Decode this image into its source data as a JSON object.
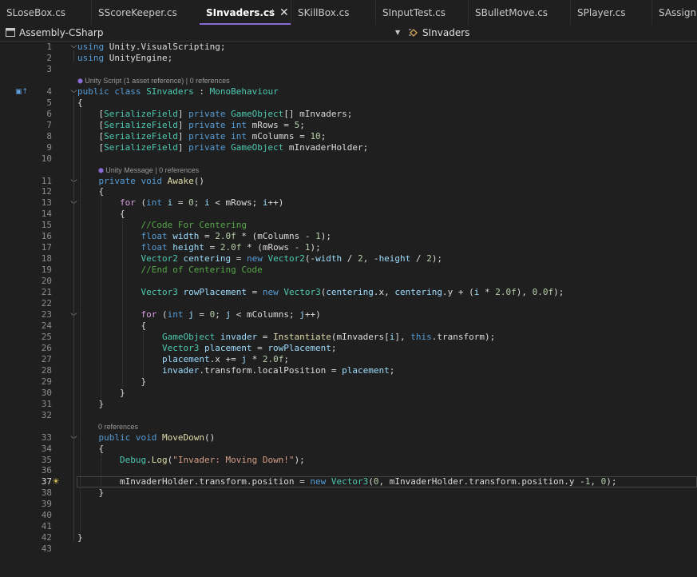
{
  "tabs": [
    {
      "label": "SLoseBox.cs",
      "active": false
    },
    {
      "label": "SScoreKeeper.cs",
      "active": false
    },
    {
      "label": "SInvaders.cs",
      "active": true,
      "pin_icon": "pin-icon",
      "close_icon": "close-icon"
    },
    {
      "label": "SKillBox.cs",
      "active": false
    },
    {
      "label": "SInputTest.cs",
      "active": false
    },
    {
      "label": "SBulletMove.cs",
      "active": false
    },
    {
      "label": "SPlayer.cs",
      "active": false
    },
    {
      "label": "SAssignm",
      "active": false
    }
  ],
  "nav": {
    "project": "Assembly-CSharp",
    "class": "SInvaders",
    "project_icon": "csharp-project-icon",
    "class_icon": "class-icon",
    "dropdown_icon": "chevron-down-icon"
  },
  "editor": {
    "current_line": 37,
    "accent_color": "#8a6ad6",
    "lens_icon": "unity-icon",
    "inherit_icon": "inherits-icon",
    "quick_action_icon": "lightbulb-icon",
    "lines": [
      {
        "n": 1,
        "fold": "open",
        "tokens": [
          [
            "kw",
            "using"
          ],
          [
            "pl",
            " Unity.VisualScripting;"
          ]
        ]
      },
      {
        "n": 2,
        "tokens": [
          [
            "kw",
            "using"
          ],
          [
            "pl",
            " UnityEngine;"
          ]
        ]
      },
      {
        "n": 3,
        "tokens": []
      },
      {
        "lens": "Unity Script (1 asset reference) | 0 references",
        "lens_icon": true,
        "lens_indent": 0
      },
      {
        "n": 4,
        "fold": "open",
        "tokens": [
          [
            "kw",
            "public"
          ],
          [
            "pl",
            " "
          ],
          [
            "kw",
            "class"
          ],
          [
            "pl",
            " "
          ],
          [
            "ty",
            "SInvaders"
          ],
          [
            "pl",
            " : "
          ],
          [
            "ty",
            "MonoBehaviour"
          ]
        ]
      },
      {
        "n": 5,
        "tokens": [
          [
            "pl",
            "{"
          ]
        ]
      },
      {
        "n": 6,
        "tokens": [
          [
            "pl",
            "    ["
          ],
          [
            "ty",
            "SerializeField"
          ],
          [
            "pl",
            "] "
          ],
          [
            "kw",
            "private"
          ],
          [
            "pl",
            " "
          ],
          [
            "ty",
            "GameObject"
          ],
          [
            "pl",
            "[] mInvaders;"
          ]
        ]
      },
      {
        "n": 7,
        "tokens": [
          [
            "pl",
            "    ["
          ],
          [
            "ty",
            "SerializeField"
          ],
          [
            "pl",
            "] "
          ],
          [
            "kw",
            "private"
          ],
          [
            "pl",
            " "
          ],
          [
            "kw",
            "int"
          ],
          [
            "pl",
            " mRows = "
          ],
          [
            "nm",
            "5"
          ],
          [
            "pl",
            ";"
          ]
        ]
      },
      {
        "n": 8,
        "tokens": [
          [
            "pl",
            "    ["
          ],
          [
            "ty",
            "SerializeField"
          ],
          [
            "pl",
            "] "
          ],
          [
            "kw",
            "private"
          ],
          [
            "pl",
            " "
          ],
          [
            "kw",
            "int"
          ],
          [
            "pl",
            " mColumns = "
          ],
          [
            "nm",
            "10"
          ],
          [
            "pl",
            ";"
          ]
        ]
      },
      {
        "n": 9,
        "tokens": [
          [
            "pl",
            "    ["
          ],
          [
            "ty",
            "SerializeField"
          ],
          [
            "pl",
            "] "
          ],
          [
            "kw",
            "private"
          ],
          [
            "pl",
            " "
          ],
          [
            "ty",
            "GameObject"
          ],
          [
            "pl",
            " mInvaderHolder;"
          ]
        ]
      },
      {
        "n": 10,
        "tokens": []
      },
      {
        "lens": "Unity Message | 0 references",
        "lens_icon": true,
        "lens_indent": 4
      },
      {
        "n": 11,
        "fold": "open",
        "tokens": [
          [
            "pl",
            "    "
          ],
          [
            "kw",
            "private"
          ],
          [
            "pl",
            " "
          ],
          [
            "kw",
            "void"
          ],
          [
            "pl",
            " "
          ],
          [
            "mt",
            "Awake"
          ],
          [
            "pl",
            "()"
          ]
        ]
      },
      {
        "n": 12,
        "tokens": [
          [
            "pl",
            "    {"
          ]
        ]
      },
      {
        "n": 13,
        "fold": "open",
        "tokens": [
          [
            "pl",
            "        "
          ],
          [
            "kc",
            "for"
          ],
          [
            "pl",
            " ("
          ],
          [
            "kw",
            "int"
          ],
          [
            "pl",
            " "
          ],
          [
            "vr",
            "i"
          ],
          [
            "pl",
            " = "
          ],
          [
            "nm",
            "0"
          ],
          [
            "pl",
            "; "
          ],
          [
            "vr",
            "i"
          ],
          [
            "pl",
            " < mRows; "
          ],
          [
            "vr",
            "i"
          ],
          [
            "pl",
            "++)"
          ]
        ]
      },
      {
        "n": 14,
        "tokens": [
          [
            "pl",
            "        {"
          ]
        ]
      },
      {
        "n": 15,
        "tokens": [
          [
            "pl",
            "            "
          ],
          [
            "cm",
            "//Code For Centering"
          ]
        ]
      },
      {
        "n": 16,
        "tokens": [
          [
            "pl",
            "            "
          ],
          [
            "kw",
            "float"
          ],
          [
            "pl",
            " "
          ],
          [
            "vr",
            "width"
          ],
          [
            "pl",
            " = "
          ],
          [
            "nm",
            "2.0f"
          ],
          [
            "pl",
            " * (mColumns - "
          ],
          [
            "nm",
            "1"
          ],
          [
            "pl",
            ");"
          ]
        ]
      },
      {
        "n": 17,
        "tokens": [
          [
            "pl",
            "            "
          ],
          [
            "kw",
            "float"
          ],
          [
            "pl",
            " "
          ],
          [
            "vr",
            "height"
          ],
          [
            "pl",
            " = "
          ],
          [
            "nm",
            "2.0f"
          ],
          [
            "pl",
            " * (mRows - "
          ],
          [
            "nm",
            "1"
          ],
          [
            "pl",
            ");"
          ]
        ]
      },
      {
        "n": 18,
        "tokens": [
          [
            "pl",
            "            "
          ],
          [
            "ty",
            "Vector2"
          ],
          [
            "pl",
            " "
          ],
          [
            "vr",
            "centering"
          ],
          [
            "pl",
            " = "
          ],
          [
            "kw",
            "new"
          ],
          [
            "pl",
            " "
          ],
          [
            "ty",
            "Vector2"
          ],
          [
            "pl",
            "(-"
          ],
          [
            "vr",
            "width"
          ],
          [
            "pl",
            " / "
          ],
          [
            "nm",
            "2"
          ],
          [
            "pl",
            ", -"
          ],
          [
            "vr",
            "height"
          ],
          [
            "pl",
            " / "
          ],
          [
            "nm",
            "2"
          ],
          [
            "pl",
            ");"
          ]
        ]
      },
      {
        "n": 19,
        "tokens": [
          [
            "pl",
            "            "
          ],
          [
            "cm",
            "//End of Centering Code"
          ]
        ]
      },
      {
        "n": 20,
        "tokens": []
      },
      {
        "n": 21,
        "tokens": [
          [
            "pl",
            "            "
          ],
          [
            "ty",
            "Vector3"
          ],
          [
            "pl",
            " "
          ],
          [
            "vr",
            "rowPlacement"
          ],
          [
            "pl",
            " = "
          ],
          [
            "kw",
            "new"
          ],
          [
            "pl",
            " "
          ],
          [
            "ty",
            "Vector3"
          ],
          [
            "pl",
            "("
          ],
          [
            "vr",
            "centering"
          ],
          [
            "pl",
            ".x, "
          ],
          [
            "vr",
            "centering"
          ],
          [
            "pl",
            ".y + ("
          ],
          [
            "vr",
            "i"
          ],
          [
            "pl",
            " * "
          ],
          [
            "nm",
            "2.0f"
          ],
          [
            "pl",
            "), "
          ],
          [
            "nm",
            "0.0f"
          ],
          [
            "pl",
            ");"
          ]
        ]
      },
      {
        "n": 22,
        "tokens": []
      },
      {
        "n": 23,
        "fold": "open",
        "tokens": [
          [
            "pl",
            "            "
          ],
          [
            "kc",
            "for"
          ],
          [
            "pl",
            " ("
          ],
          [
            "kw",
            "int"
          ],
          [
            "pl",
            " "
          ],
          [
            "vr",
            "j"
          ],
          [
            "pl",
            " = "
          ],
          [
            "nm",
            "0"
          ],
          [
            "pl",
            "; "
          ],
          [
            "vr",
            "j"
          ],
          [
            "pl",
            " < mColumns; "
          ],
          [
            "vr",
            "j"
          ],
          [
            "pl",
            "++)"
          ]
        ]
      },
      {
        "n": 24,
        "tokens": [
          [
            "pl",
            "            {"
          ]
        ]
      },
      {
        "n": 25,
        "tokens": [
          [
            "pl",
            "                "
          ],
          [
            "ty",
            "GameObject"
          ],
          [
            "pl",
            " "
          ],
          [
            "vr",
            "invader"
          ],
          [
            "pl",
            " = "
          ],
          [
            "mt",
            "Instantiate"
          ],
          [
            "pl",
            "(mInvaders["
          ],
          [
            "vr",
            "i"
          ],
          [
            "pl",
            "], "
          ],
          [
            "kw",
            "this"
          ],
          [
            "pl",
            ".transform);"
          ]
        ]
      },
      {
        "n": 26,
        "tokens": [
          [
            "pl",
            "                "
          ],
          [
            "ty",
            "Vector3"
          ],
          [
            "pl",
            " "
          ],
          [
            "vr",
            "placement"
          ],
          [
            "pl",
            " = "
          ],
          [
            "vr",
            "rowPlacement"
          ],
          [
            "pl",
            ";"
          ]
        ]
      },
      {
        "n": 27,
        "tokens": [
          [
            "pl",
            "                "
          ],
          [
            "vr",
            "placement"
          ],
          [
            "pl",
            ".x += "
          ],
          [
            "vr",
            "j"
          ],
          [
            "pl",
            " * "
          ],
          [
            "nm",
            "2.0f"
          ],
          [
            "pl",
            ";"
          ]
        ]
      },
      {
        "n": 28,
        "tokens": [
          [
            "pl",
            "                "
          ],
          [
            "vr",
            "invader"
          ],
          [
            "pl",
            ".transform.localPosition = "
          ],
          [
            "vr",
            "placement"
          ],
          [
            "pl",
            ";"
          ]
        ]
      },
      {
        "n": 29,
        "tokens": [
          [
            "pl",
            "            }"
          ]
        ]
      },
      {
        "n": 30,
        "tokens": [
          [
            "pl",
            "        }"
          ]
        ]
      },
      {
        "n": 31,
        "tokens": [
          [
            "pl",
            "    }"
          ]
        ]
      },
      {
        "n": 32,
        "tokens": []
      },
      {
        "lens": "0 references",
        "lens_icon": false,
        "lens_indent": 4
      },
      {
        "n": 33,
        "fold": "open",
        "tokens": [
          [
            "pl",
            "    "
          ],
          [
            "kw",
            "public"
          ],
          [
            "pl",
            " "
          ],
          [
            "kw",
            "void"
          ],
          [
            "pl",
            " "
          ],
          [
            "mt",
            "MoveDown"
          ],
          [
            "pl",
            "()"
          ]
        ]
      },
      {
        "n": 34,
        "tokens": [
          [
            "pl",
            "    {"
          ]
        ]
      },
      {
        "n": 35,
        "tokens": [
          [
            "pl",
            "        "
          ],
          [
            "ty",
            "Debug"
          ],
          [
            "pl",
            "."
          ],
          [
            "mt",
            "Log"
          ],
          [
            "pl",
            "("
          ],
          [
            "sr",
            "\"Invader: Moving Down!\""
          ],
          [
            "pl",
            ");"
          ]
        ]
      },
      {
        "n": 36,
        "tokens": []
      },
      {
        "n": 37,
        "tokens": [
          [
            "pl",
            "        mInvaderHolder.transform.position = "
          ],
          [
            "kw",
            "new"
          ],
          [
            "pl",
            " "
          ],
          [
            "ty",
            "Vector3"
          ],
          [
            "pl",
            "("
          ],
          [
            "nm",
            "0"
          ],
          [
            "pl",
            ", mInvaderHolder.transform.position.y -"
          ],
          [
            "nm",
            "1"
          ],
          [
            "pl",
            ", "
          ],
          [
            "nm",
            "0"
          ],
          [
            "pl",
            ");"
          ]
        ]
      },
      {
        "n": 38,
        "tokens": [
          [
            "pl",
            "    }"
          ]
        ]
      },
      {
        "n": 39,
        "tokens": []
      },
      {
        "n": 40,
        "tokens": []
      },
      {
        "n": 41,
        "tokens": []
      },
      {
        "n": 42,
        "tokens": [
          [
            "pl",
            "}"
          ]
        ]
      },
      {
        "n": 43,
        "tokens": []
      }
    ]
  }
}
